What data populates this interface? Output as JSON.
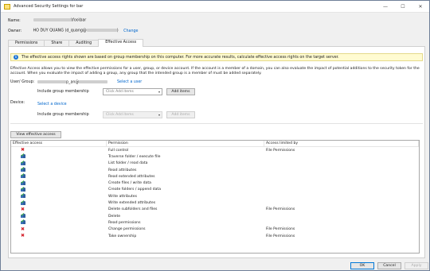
{
  "window": {
    "title": "Advanced Security Settings for bar",
    "controls": [
      "minimize-icon",
      "maximize-icon",
      "close-icon"
    ],
    "minimize_glyph": "—",
    "maximize_glyph": "☐",
    "close_glyph": "✕"
  },
  "info": {
    "name_label": "Name:",
    "name_value_suffix": "\\foo\\bar",
    "owner_label": "Owner:",
    "owner_value": "HO DUY QUANG (d_quang@",
    "owner_value_end": ")",
    "change_link": "Change"
  },
  "tabs": [
    {
      "label": "Permissions",
      "active": false
    },
    {
      "label": "Share",
      "active": false
    },
    {
      "label": "Auditing",
      "active": false
    },
    {
      "label": "Effective Access",
      "active": true
    }
  ],
  "banner": {
    "icon": "info-icon",
    "text": "The effective access rights shown are based on group membership on this computer. For more accurate results, calculate effective access rights on the target server."
  },
  "description": "Effective Access allows you to view the effective permissions for a user, group, or device account. If the account is a member of a domain, you can also evaluate the impact of potential additions to the security token for the account. When you evaluate the impact of adding a group, any group that the intended group is a member of must be added separately.",
  "user_group": {
    "label": "User/ Group:",
    "value_prefix": "",
    "value_suffix": "p_an@",
    "select_link": "Select a user",
    "include_label": "Include group membership",
    "combo_placeholder": "Click Add items",
    "add_button": "Add items"
  },
  "device": {
    "label": "Device:",
    "select_link": "Select a device",
    "include_label": "Include group membership",
    "combo_placeholder": "Click Add items",
    "add_button": "Add items"
  },
  "view_button": "View effective access",
  "grid": {
    "columns": [
      "Effective access",
      "Permission",
      "Access limited by"
    ],
    "rows": [
      {
        "access": "deny",
        "permission": "Full control",
        "limited_by": "File Permissions"
      },
      {
        "access": "allow",
        "permission": "Traverse folder / execute file",
        "limited_by": ""
      },
      {
        "access": "allow",
        "permission": "List folder / read data",
        "limited_by": ""
      },
      {
        "access": "allow",
        "permission": "Read attributes",
        "limited_by": ""
      },
      {
        "access": "allow",
        "permission": "Read extended attributes",
        "limited_by": ""
      },
      {
        "access": "allow",
        "permission": "Create files / write data",
        "limited_by": ""
      },
      {
        "access": "allow",
        "permission": "Create folders / append data",
        "limited_by": ""
      },
      {
        "access": "allow",
        "permission": "Write attributes",
        "limited_by": ""
      },
      {
        "access": "allow",
        "permission": "Write extended attributes",
        "limited_by": ""
      },
      {
        "access": "deny",
        "permission": "Delete subfolders and files",
        "limited_by": "File Permissions"
      },
      {
        "access": "allow",
        "permission": "Delete",
        "limited_by": ""
      },
      {
        "access": "allow",
        "permission": "Read permissions",
        "limited_by": ""
      },
      {
        "access": "deny",
        "permission": "Change permissions",
        "limited_by": "File Permissions"
      },
      {
        "access": "deny",
        "permission": "Take ownership",
        "limited_by": "File Permissions"
      }
    ]
  },
  "footer": {
    "ok": "OK",
    "cancel": "Cancel",
    "apply": "Apply"
  }
}
